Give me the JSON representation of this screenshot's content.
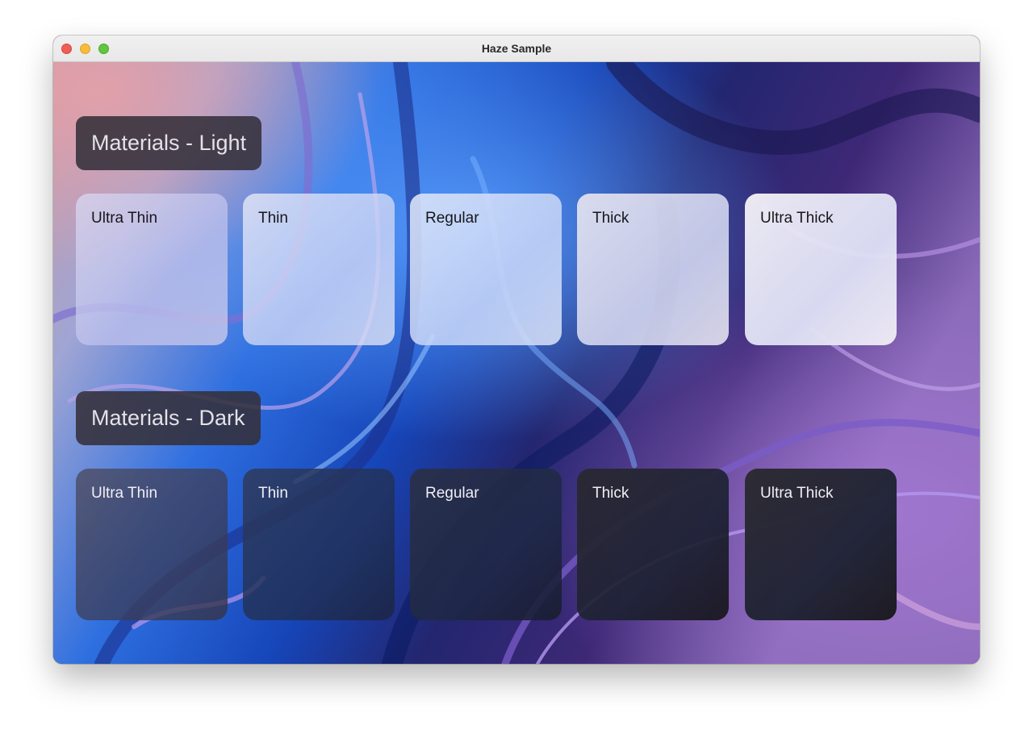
{
  "window": {
    "title": "Haze Sample"
  },
  "sections": [
    {
      "title": "Materials - Light",
      "theme": "light",
      "cards": [
        {
          "label": "Ultra Thin",
          "tint": "#c8c4e8"
        },
        {
          "label": "Thin",
          "tint": "#d7dbf2"
        },
        {
          "label": "Regular",
          "tint": "#d2dcf6"
        },
        {
          "label": "Thick",
          "tint": "#dcdaea"
        },
        {
          "label": "Ultra Thick",
          "tint": "#ece8f1"
        }
      ]
    },
    {
      "title": "Materials - Dark",
      "theme": "dark",
      "cards": [
        {
          "label": "Ultra Thin",
          "tint": "#3f3e54"
        },
        {
          "label": "Thin",
          "tint": "#1f2b4d"
        },
        {
          "label": "Regular",
          "tint": "#1c2136"
        },
        {
          "label": "Thick",
          "tint": "#1c1a21"
        },
        {
          "label": "Ultra Thick",
          "tint": "#1e1c22"
        }
      ]
    }
  ]
}
